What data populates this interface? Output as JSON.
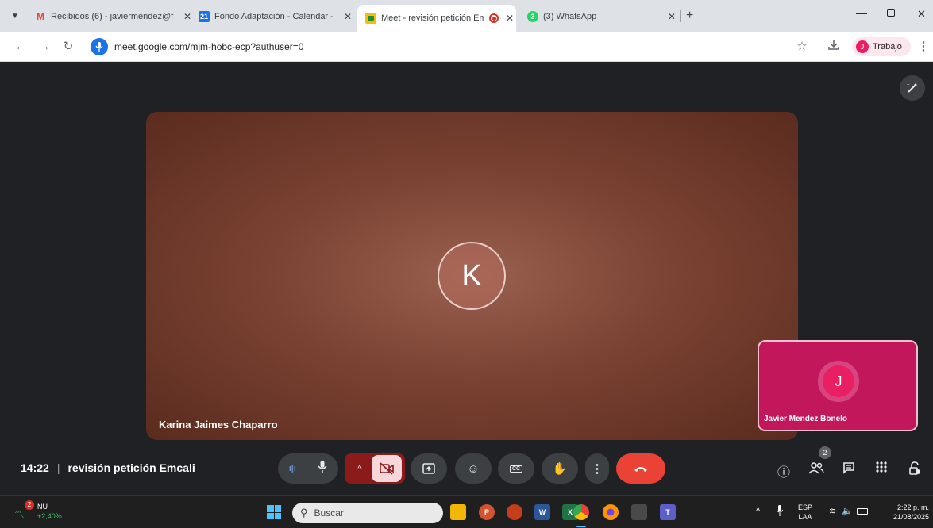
{
  "browser": {
    "tabs": [
      {
        "title": "Recibidos (6) - javiermendez@f",
        "icon": "gmail-icon"
      },
      {
        "title": "Fondo Adaptación - Calendar -",
        "icon": "calendar-icon",
        "badge": "21"
      },
      {
        "title": "Meet - revisión petición Em",
        "icon": "meet-icon",
        "recording": true
      },
      {
        "title": "(3) WhatsApp",
        "icon": "whatsapp-icon",
        "badge": "3"
      }
    ],
    "url": "meet.google.com/mjm-hobc-ecp?authuser=0",
    "profile": {
      "initial": "J",
      "label": "Trabajo"
    }
  },
  "meet": {
    "main_participant": {
      "initial": "K",
      "name": "Karina Jaimes Chaparro"
    },
    "self_participant": {
      "initial": "J",
      "name": "Javier Mendez Bonelo"
    },
    "time": "14:22",
    "meeting_name": "revisión petición Emcali",
    "participant_count": "2",
    "colors": {
      "main_tile": "#7a4232",
      "self_tile": "#c2185b",
      "end_call": "#ea4335",
      "cam_off": "#8b1a1a"
    }
  },
  "taskbar": {
    "search_placeholder": "Buscar",
    "stock": {
      "symbol": "NU",
      "change": "+2,40%",
      "badge": "2"
    },
    "language": {
      "top": "ESP",
      "bottom": "LAA"
    },
    "clock": {
      "time": "2:22 p. m.",
      "date": "21/08/2025"
    },
    "pinned": [
      "file-explorer-icon",
      "powerpoint-icon",
      "app-icon",
      "word-icon",
      "excel-icon",
      "chrome-icon",
      "firefox-icon",
      "app-icon",
      "teams-icon"
    ]
  }
}
